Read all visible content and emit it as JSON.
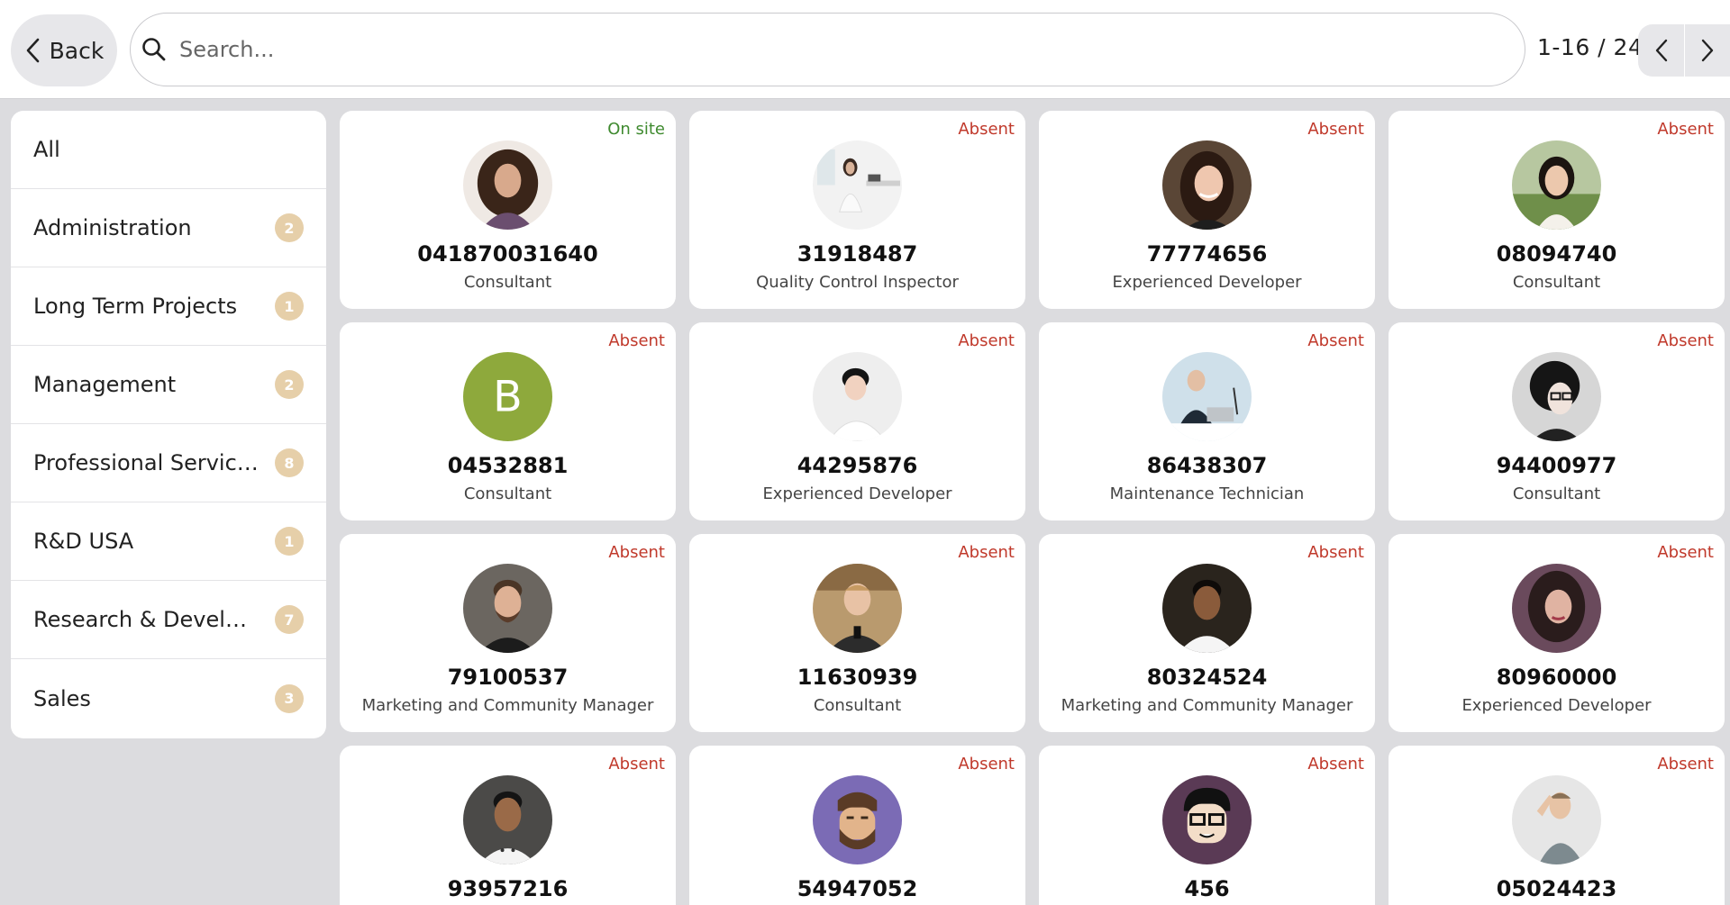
{
  "nav": {
    "back_label": "Back",
    "search_placeholder": "Search...",
    "pager_text": "1-16 / 24"
  },
  "colors": {
    "badge": "#e6cfa9",
    "on_site": "#3f8a2f",
    "absent": "#c0392b",
    "letter_avatar": "#8ea93c"
  },
  "sidebar": {
    "items": [
      {
        "label": "All",
        "count": null
      },
      {
        "label": "Administration",
        "count": "2"
      },
      {
        "label": "Long Term Projects",
        "count": "1"
      },
      {
        "label": "Management",
        "count": "2"
      },
      {
        "label": "Professional Services",
        "count": "8"
      },
      {
        "label": "R&D USA",
        "count": "1"
      },
      {
        "label": "Research & Develop...",
        "count": "7"
      },
      {
        "label": "Sales",
        "count": "3"
      }
    ]
  },
  "employees": [
    {
      "name": "041870031640",
      "job": "Consultant",
      "status": "On site",
      "avatar": "woman-curly-photo"
    },
    {
      "name": "31918487",
      "job": "Quality Control Inspector",
      "status": "Absent",
      "avatar": "woman-office-photo"
    },
    {
      "name": "77774656",
      "job": "Experienced Developer",
      "status": "Absent",
      "avatar": "woman-smiling-photo"
    },
    {
      "name": "08094740",
      "job": "Consultant",
      "status": "Absent",
      "avatar": "woman-outdoor-photo"
    },
    {
      "name": "04532881",
      "job": "Consultant",
      "status": "Absent",
      "avatar": "letter-avatar",
      "initial": "B"
    },
    {
      "name": "44295876",
      "job": "Experienced Developer",
      "status": "Absent",
      "avatar": "man-white-shirt-photo"
    },
    {
      "name": "86438307",
      "job": "Maintenance Technician",
      "status": "Absent",
      "avatar": "man-desk-photo"
    },
    {
      "name": "94400977",
      "job": "Consultant",
      "status": "Absent",
      "avatar": "woman-glasses-photo"
    },
    {
      "name": "79100537",
      "job": "Marketing and Community Manager",
      "status": "Absent",
      "avatar": "man-beard-photo"
    },
    {
      "name": "11630939",
      "job": "Consultant",
      "status": "Absent",
      "avatar": "man-smiling-photo"
    },
    {
      "name": "80324524",
      "job": "Marketing and Community Manager",
      "status": "Absent",
      "avatar": "man-dark-photo"
    },
    {
      "name": "80960000",
      "job": "Experienced Developer",
      "status": "Absent",
      "avatar": "woman-dark-hair-photo"
    },
    {
      "name": "93957216",
      "job": "",
      "status": "Absent",
      "avatar": "man-chef-photo"
    },
    {
      "name": "54947052",
      "job": "",
      "status": "Absent",
      "avatar": "cartoon-man-beard"
    },
    {
      "name": "456",
      "job": "",
      "status": "Absent",
      "avatar": "cartoon-man-glasses"
    },
    {
      "name": "05024423",
      "job": "",
      "status": "Absent",
      "avatar": "man-hand-head-photo"
    }
  ]
}
